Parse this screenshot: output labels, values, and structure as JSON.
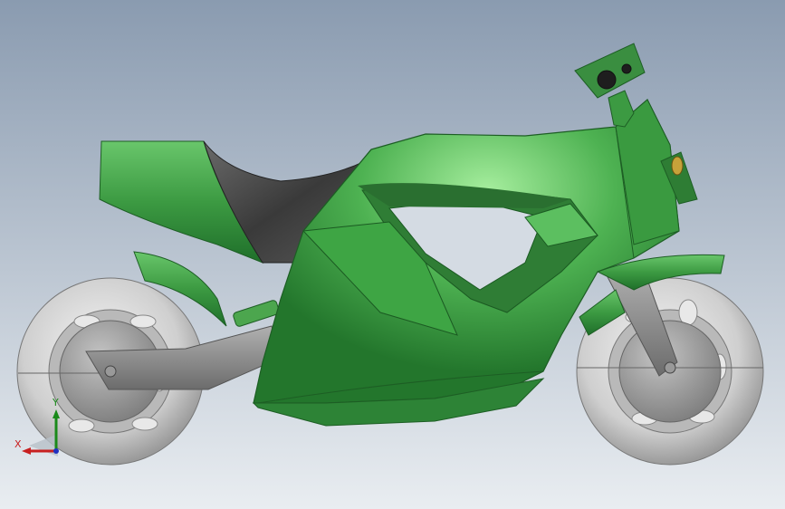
{
  "viewport": {
    "background_top": "#8a9bb0",
    "background_bottom": "#e9edf1"
  },
  "model": {
    "body_color": "#3c9a42",
    "body_highlight": "#8fe08f",
    "body_shadow": "#1f6f2a",
    "seat_color": "#4a4a4a",
    "metal_color": "#8c8c8c",
    "tire_color": "#d9d9d9"
  },
  "triad": {
    "x_label": "X",
    "y_label": "Y",
    "x_color": "#c82020",
    "y_color": "#1a8a1a",
    "z_color": "#2030c0"
  }
}
